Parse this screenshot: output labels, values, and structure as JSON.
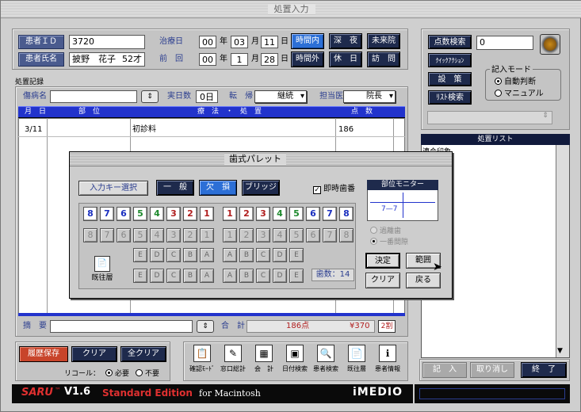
{
  "window": {
    "title": "処置入力"
  },
  "patient": {
    "id_label": "患者ＩＤ",
    "id_value": "3720",
    "name_label": "患者氏名",
    "name_value": "披野　花子",
    "age": "52才"
  },
  "visit": {
    "date_label": "治療日",
    "prev_label": "前　回",
    "era1": "00",
    "y1": "年",
    "m1_val": "03",
    "m1": "月",
    "d1_val": "11",
    "d1": "日",
    "era2": "00",
    "y2": "年",
    "m2_val": "1",
    "m2": "月",
    "d2_val": "28",
    "d2": "日"
  },
  "time_buttons": {
    "in_hours": "時間内",
    "late_night": "深　夜",
    "preschool": "未来院",
    "after_hours": "時間外",
    "holiday": "休　日",
    "visit": "訪　問"
  },
  "right_top": {
    "points_search": "点数検索",
    "quick_action": "ｸｲｯｸｱｸｼｮﾝ",
    "settings": "設　策",
    "list_search": "ﾘｽﾄ検索",
    "field_value": "0",
    "entry_mode_label": "記入モード",
    "auto": "自動判断",
    "manual": "マニュアル"
  },
  "record": {
    "section_label": "処置記録",
    "disease_label": "傷病名",
    "actual_days_label": "実日数",
    "actual_days_value": "0日",
    "outcome_label": "転　帰",
    "outcome_value": "継続",
    "doctor_label": "担当医",
    "doctor_value": "院長"
  },
  "table": {
    "headers": [
      "月　日",
      "部　位",
      "療　法　・　処　置",
      "点　数"
    ],
    "rows": [
      {
        "date": "3/11",
        "site": "",
        "treatment": "初診料",
        "points": "186"
      }
    ]
  },
  "summary": {
    "summary_label": "摘　要",
    "total_label": "合　計",
    "total_points": "186点",
    "total_yen": "¥370",
    "ratio": "2割"
  },
  "bottom_left": {
    "save_history": "履歴保存",
    "clear": "クリア",
    "clear_all": "全クリア",
    "recall_label": "リコール：",
    "required": "必要",
    "unneeded": "不要"
  },
  "toolbar": [
    {
      "label": "確認ﾓｰﾄﾞ",
      "icon": "clipboard-icon"
    },
    {
      "label": "窓口総計",
      "icon": "pencil-icon"
    },
    {
      "label": "会　計",
      "icon": "calculator-icon"
    },
    {
      "label": "日付検索",
      "icon": "calendar-icon"
    },
    {
      "label": "患者検索",
      "icon": "patient-search-icon"
    },
    {
      "label": "既往層",
      "icon": "history-icon"
    },
    {
      "label": "患者情報",
      "icon": "patient-info-icon"
    }
  ],
  "right_list": {
    "title": "処置リスト",
    "item": "連合印象"
  },
  "right_bottom": {
    "enter": "記　入",
    "cancel": "取り消し",
    "finish": "終　了"
  },
  "brand": {
    "product": "SARU",
    "version": "V1.6",
    "edition": "Standard Edition",
    "platform": "for Macintosh",
    "company": "iMEDIO"
  },
  "palette": {
    "title": "歯式パレット",
    "input_key": "入力キー選択",
    "general": "一　般",
    "missing": "欠　損",
    "bridge": "ブリッジ",
    "instant": "即時歯番",
    "monitor_label": "部位モニター",
    "monitor_value": "7—7",
    "past": "過離歯",
    "onecol": "一番間隙",
    "decide": "決定",
    "range": "範囲",
    "clear": "クリア",
    "back": "戻る",
    "count": "歯数：14",
    "history": "既往層",
    "upper_right": [
      "8",
      "7",
      "6",
      "5",
      "4",
      "3",
      "2",
      "1"
    ],
    "upper_left": [
      "1",
      "2",
      "3",
      "4",
      "5",
      "6",
      "7",
      "8"
    ],
    "deciduous_right": [
      "E",
      "D",
      "C",
      "B",
      "A"
    ],
    "deciduous_left": [
      "A",
      "B",
      "C",
      "D",
      "E"
    ],
    "upper_colors": [
      "#1a2fbf",
      "#1a2fbf",
      "#1a2fbf",
      "#1f8a2e",
      "#1f8a2e",
      "#b01e1e",
      "#b01e1e",
      "#b01e1e"
    ]
  }
}
